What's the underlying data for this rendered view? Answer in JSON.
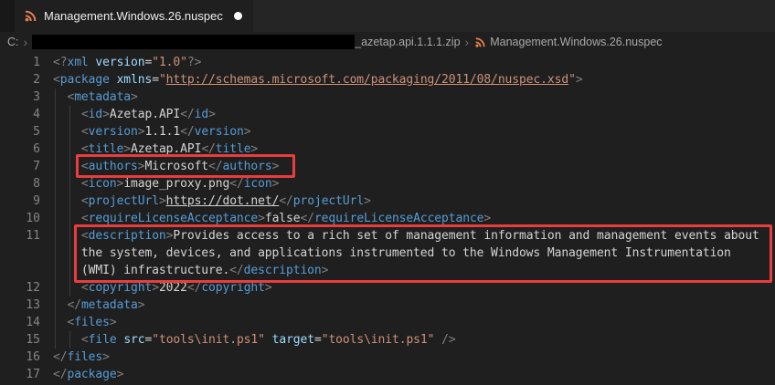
{
  "tab": {
    "title": "Management.Windows.26.nuspec",
    "icon": "nuspec-rss-icon",
    "modified": true
  },
  "breadcrumb": {
    "drive": "C:",
    "separator": "›",
    "redacted_segment": "black-redaction-bar",
    "archive": "_azetap.api.1.1.1.zip",
    "file_icon": "nuspec-rss-icon",
    "file": "Management.Windows.26.nuspec"
  },
  "colors": {
    "editor_bg": "#1f1f1f",
    "tabbar_bg": "#252526",
    "tab_bg": "#1f1f1f",
    "strip_bg": "#181818",
    "highlight_red": "#e93d3d",
    "tag_blue": "#569cd6",
    "attr_blue": "#9cdcfe",
    "string_orange": "#ce9178",
    "punct_gray": "#808080",
    "text_light": "#d4d4d4",
    "line_number_gray": "#858585",
    "breadcrumb_gray": "#a9a9a9",
    "icon_orange": "#e8834c",
    "redaction_black": "#000000",
    "modified_dot": "#ffffff"
  },
  "annotations": [
    {
      "name": "highlight-box-authors",
      "around": "line 7 <authors>Microsoft</authors>"
    },
    {
      "name": "highlight-box-description",
      "around": "line 11 description block"
    }
  ],
  "editor": {
    "rows": [
      {
        "n": "1",
        "g": 0,
        "s": [
          [
            "p",
            "<?"
          ],
          [
            "tag",
            "xml"
          ],
          [
            "txt",
            " "
          ],
          [
            "attr",
            "version"
          ],
          [
            "eq",
            "="
          ],
          [
            "str",
            "\"1.0\""
          ],
          [
            "p",
            "?>"
          ]
        ]
      },
      {
        "n": "2",
        "g": 0,
        "s": [
          [
            "p",
            "<"
          ],
          [
            "tag",
            "package"
          ],
          [
            "txt",
            " "
          ],
          [
            "attr",
            "xmlns"
          ],
          [
            "eq",
            "="
          ],
          [
            "str",
            "\""
          ],
          [
            "url",
            "http://schemas.microsoft.com/packaging/2011/08/nuspec.xsd"
          ],
          [
            "str",
            "\""
          ],
          [
            "p",
            ">"
          ]
        ]
      },
      {
        "n": "3",
        "g": 1,
        "s": [
          [
            "txt",
            "  "
          ],
          [
            "p",
            "<"
          ],
          [
            "tag",
            "metadata"
          ],
          [
            "p",
            ">"
          ]
        ]
      },
      {
        "n": "4",
        "g": 2,
        "s": [
          [
            "txt",
            "    "
          ],
          [
            "p",
            "<"
          ],
          [
            "tag",
            "id"
          ],
          [
            "p",
            ">"
          ],
          [
            "txt",
            "Azetap.API"
          ],
          [
            "p",
            "</"
          ],
          [
            "tag",
            "id"
          ],
          [
            "p",
            ">"
          ]
        ]
      },
      {
        "n": "5",
        "g": 2,
        "s": [
          [
            "txt",
            "    "
          ],
          [
            "p",
            "<"
          ],
          [
            "tag",
            "version"
          ],
          [
            "p",
            ">"
          ],
          [
            "txt",
            "1.1.1"
          ],
          [
            "p",
            "</"
          ],
          [
            "tag",
            "version"
          ],
          [
            "p",
            ">"
          ]
        ]
      },
      {
        "n": "6",
        "g": 2,
        "s": [
          [
            "txt",
            "    "
          ],
          [
            "p",
            "<"
          ],
          [
            "tag",
            "title"
          ],
          [
            "p",
            ">"
          ],
          [
            "txt",
            "Azetap.API"
          ],
          [
            "p",
            "</"
          ],
          [
            "tag",
            "title"
          ],
          [
            "p",
            ">"
          ]
        ]
      },
      {
        "n": "7",
        "g": 2,
        "s": [
          [
            "txt",
            "    "
          ],
          [
            "p",
            "<"
          ],
          [
            "tag",
            "authors"
          ],
          [
            "p",
            ">"
          ],
          [
            "txt",
            "Microsoft"
          ],
          [
            "p",
            "</"
          ],
          [
            "tag",
            "authors"
          ],
          [
            "p",
            ">"
          ]
        ]
      },
      {
        "n": "8",
        "g": 2,
        "s": [
          [
            "txt",
            "    "
          ],
          [
            "p",
            "<"
          ],
          [
            "tag",
            "icon"
          ],
          [
            "p",
            ">"
          ],
          [
            "txt",
            "image_proxy.png"
          ],
          [
            "p",
            "</"
          ],
          [
            "tag",
            "icon"
          ],
          [
            "p",
            ">"
          ]
        ]
      },
      {
        "n": "9",
        "g": 2,
        "s": [
          [
            "txt",
            "    "
          ],
          [
            "p",
            "<"
          ],
          [
            "tag",
            "projectUrl"
          ],
          [
            "p",
            ">"
          ],
          [
            "link",
            "https://dot.net/"
          ],
          [
            "p",
            "</"
          ],
          [
            "tag",
            "projectUrl"
          ],
          [
            "p",
            ">"
          ]
        ]
      },
      {
        "n": "10",
        "g": 2,
        "s": [
          [
            "txt",
            "    "
          ],
          [
            "p",
            "<"
          ],
          [
            "tag",
            "requireLicenseAcceptance"
          ],
          [
            "p",
            ">"
          ],
          [
            "txt",
            "false"
          ],
          [
            "p",
            "</"
          ],
          [
            "tag",
            "requireLicenseAcceptance"
          ],
          [
            "p",
            ">"
          ]
        ]
      },
      {
        "n": "11",
        "g": 2,
        "s": [
          [
            "txt",
            "    "
          ],
          [
            "p",
            "<"
          ],
          [
            "tag",
            "description"
          ],
          [
            "p",
            ">"
          ],
          [
            "txt",
            "Provides access to a rich set of management information and management events about"
          ]
        ]
      },
      {
        "n": "",
        "g": 2,
        "s": [
          [
            "txt",
            "    the system, devices, and applications instrumented to the Windows Management Instrumentation"
          ]
        ]
      },
      {
        "n": "",
        "g": 2,
        "s": [
          [
            "txt",
            "    (WMI) infrastructure."
          ],
          [
            "p",
            "</"
          ],
          [
            "tag",
            "description"
          ],
          [
            "p",
            ">"
          ]
        ]
      },
      {
        "n": "12",
        "g": 2,
        "s": [
          [
            "txt",
            "    "
          ],
          [
            "p",
            "<"
          ],
          [
            "tag",
            "copyright"
          ],
          [
            "p",
            ">"
          ],
          [
            "txt",
            "2022"
          ],
          [
            "p",
            "</"
          ],
          [
            "tag",
            "copyright"
          ],
          [
            "p",
            ">"
          ]
        ]
      },
      {
        "n": "13",
        "g": 1,
        "s": [
          [
            "txt",
            "  "
          ],
          [
            "p",
            "</"
          ],
          [
            "tag",
            "metadata"
          ],
          [
            "p",
            ">"
          ]
        ]
      },
      {
        "n": "14",
        "g": 1,
        "s": [
          [
            "txt",
            "  "
          ],
          [
            "p",
            "<"
          ],
          [
            "tag",
            "files"
          ],
          [
            "p",
            ">"
          ]
        ]
      },
      {
        "n": "15",
        "g": 2,
        "s": [
          [
            "txt",
            "    "
          ],
          [
            "p",
            "<"
          ],
          [
            "tag",
            "file"
          ],
          [
            "txt",
            " "
          ],
          [
            "attr",
            "src"
          ],
          [
            "eq",
            "="
          ],
          [
            "str",
            "\"tools\\init.ps1\""
          ],
          [
            "txt",
            " "
          ],
          [
            "attr",
            "target"
          ],
          [
            "eq",
            "="
          ],
          [
            "str",
            "\"tools\\init.ps1\""
          ],
          [
            "txt",
            " "
          ],
          [
            "p",
            "/>"
          ]
        ]
      },
      {
        "n": "16",
        "g": 0,
        "s": [
          [
            "p",
            "</"
          ],
          [
            "tag",
            "files"
          ],
          [
            "p",
            ">"
          ]
        ]
      },
      {
        "n": "17",
        "g": 0,
        "s": [
          [
            "p",
            "</"
          ],
          [
            "tag",
            "package"
          ],
          [
            "p",
            ">"
          ]
        ]
      }
    ]
  }
}
